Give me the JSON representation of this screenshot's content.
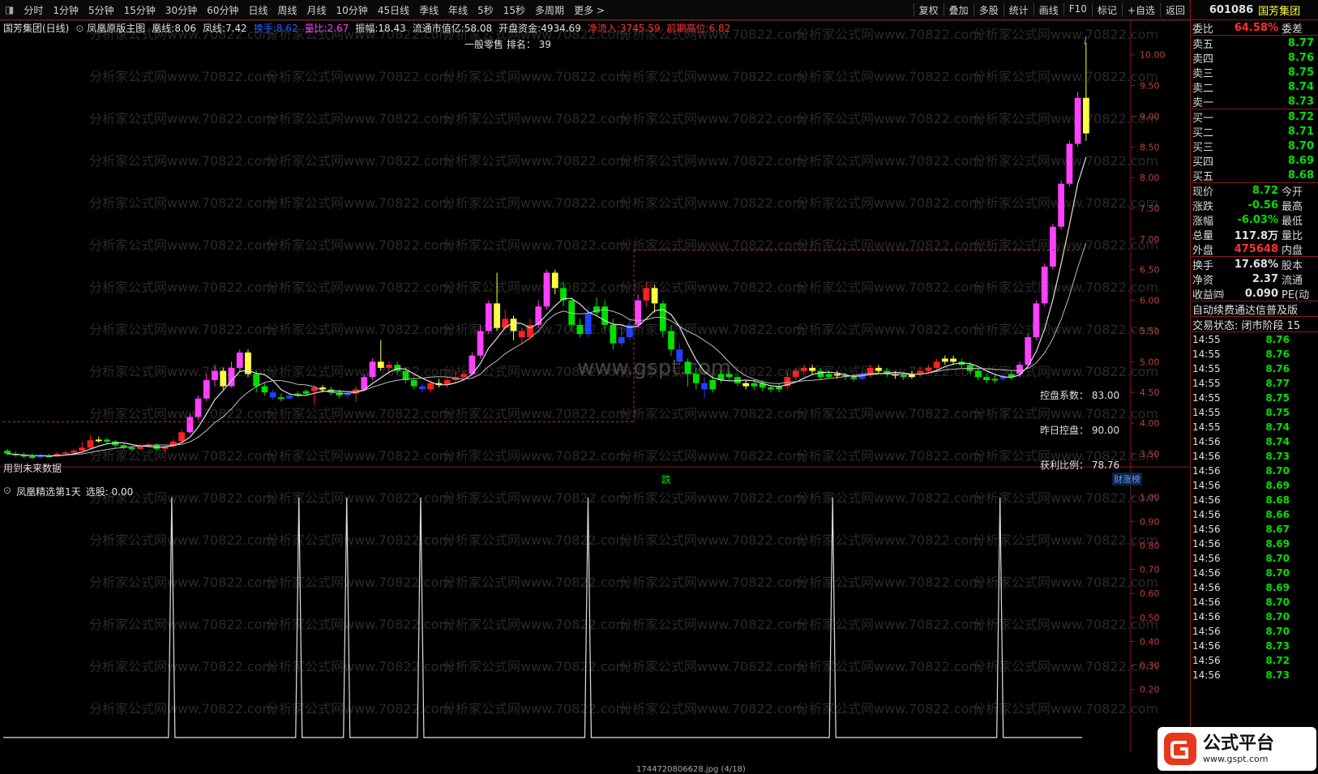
{
  "toolbar": {
    "periods": [
      "分时",
      "1分钟",
      "5分钟",
      "15分钟",
      "30分钟",
      "60分钟",
      "日线",
      "周线",
      "月线",
      "10分钟",
      "45日线",
      "季线",
      "年线",
      "5秒",
      "15秒",
      "多周期",
      "更多 >"
    ],
    "tools": [
      "复权",
      "叠加",
      "多股",
      "统计",
      "画线",
      "F10",
      "标记",
      "+自选",
      "返回"
    ]
  },
  "main_header": {
    "stock": "国芳集团(日线)",
    "indicator": "凤凰原版主图",
    "items": [
      {
        "label": "凰线:",
        "value": "8.06",
        "color": "#e0e0e0"
      },
      {
        "label": "凤线:",
        "value": "7.42",
        "color": "#e0e0e0"
      },
      {
        "label": "换手:",
        "value": "8.62",
        "color": "#2060ff"
      },
      {
        "label": "量比:",
        "value": "2.67",
        "color": "#ff40ff"
      },
      {
        "label": "振幅:",
        "value": "18.43",
        "color": "#e0e0e0"
      },
      {
        "label": "流通市值亿:",
        "value": "58.08",
        "color": "#e0e0e0"
      },
      {
        "label": "开盘资金:",
        "value": "4934.69",
        "color": "#e0e0e0"
      },
      {
        "label": "净流入:",
        "value": "3745.59",
        "color": "#ff3030"
      },
      {
        "label": "前期高位:",
        "value": "6.82",
        "color": "#ff3030"
      }
    ],
    "sector_rank": "一般零售 排名： 39"
  },
  "annotations": {
    "control_coef": "控盘系数： 83.00",
    "yesterday_control": "昨日控盘： 90.00",
    "profit_ratio": "获利比例： 78.76",
    "future_data": "用到未来数据",
    "drop_label": "跌",
    "caizhang": "财涨榜",
    "watermark_center": "www.gspt.com",
    "watermark_tile": "分析家公式网www.70822.com"
  },
  "sub_header": {
    "name": "凤凰精选第1天",
    "item": "选股: 0.00"
  },
  "price_axis": [
    "10.00",
    "9.50",
    "9.00",
    "8.50",
    "8.00",
    "7.50",
    "7.00",
    "6.50",
    "6.00",
    "5.50",
    "5.00",
    "4.50",
    "4.00",
    "3.50"
  ],
  "sub_axis": [
    "1.00",
    "0.90",
    "0.80",
    "0.70",
    "0.60",
    "0.50",
    "0.40",
    "0.30",
    "0.20"
  ],
  "right_panel": {
    "code": "601086",
    "name": "国芳集团",
    "webi": {
      "label": "委比",
      "value": "64.58%",
      "extra": "委差"
    },
    "asks": [
      {
        "label": "卖五",
        "price": "8.77"
      },
      {
        "label": "卖四",
        "price": "8.76"
      },
      {
        "label": "卖三",
        "price": "8.75"
      },
      {
        "label": "卖二",
        "price": "8.74"
      },
      {
        "label": "卖一",
        "price": "8.73"
      }
    ],
    "bids": [
      {
        "label": "买一",
        "price": "8.72"
      },
      {
        "label": "买二",
        "price": "8.71"
      },
      {
        "label": "买三",
        "price": "8.70"
      },
      {
        "label": "买四",
        "price": "8.69"
      },
      {
        "label": "买五",
        "price": "8.68"
      }
    ],
    "stats": [
      {
        "label": "现价",
        "value": "8.72",
        "extra": "今开",
        "color": "green"
      },
      {
        "label": "涨跌",
        "value": "-0.56",
        "extra": "最高",
        "color": "green"
      },
      {
        "label": "涨幅",
        "value": "-6.03%",
        "extra": "最低",
        "color": "green"
      },
      {
        "label": "总量",
        "value": "117.8万",
        "extra": "量比",
        "color": "white"
      },
      {
        "label": "外盘",
        "value": "475648",
        "extra": "内盘",
        "color": "red"
      }
    ],
    "stats2": [
      {
        "label": "换手",
        "value": "17.68%",
        "extra": "股本",
        "color": "white"
      },
      {
        "label": "净资",
        "value": "2.37",
        "extra": "流通",
        "color": "white"
      },
      {
        "label": "收益㈣",
        "value": "0.090",
        "extra": "PE(动",
        "color": "white"
      }
    ],
    "notice": "自动续费通达信普及版",
    "trade_status": "交易状态: 闭市阶段 15",
    "ticks": [
      {
        "t": "14:55",
        "p": "8.76"
      },
      {
        "t": "14:55",
        "p": "8.76"
      },
      {
        "t": "14:55",
        "p": "8.76"
      },
      {
        "t": "14:55",
        "p": "8.77"
      },
      {
        "t": "14:55",
        "p": "8.75"
      },
      {
        "t": "14:55",
        "p": "8.75"
      },
      {
        "t": "14:55",
        "p": "8.74"
      },
      {
        "t": "14:56",
        "p": "8.74"
      },
      {
        "t": "14:56",
        "p": "8.73"
      },
      {
        "t": "14:56",
        "p": "8.70"
      },
      {
        "t": "14:56",
        "p": "8.69"
      },
      {
        "t": "14:56",
        "p": "8.68"
      },
      {
        "t": "14:56",
        "p": "8.66"
      },
      {
        "t": "14:56",
        "p": "8.67"
      },
      {
        "t": "14:56",
        "p": "8.69"
      },
      {
        "t": "14:56",
        "p": "8.70"
      },
      {
        "t": "14:56",
        "p": "8.70"
      },
      {
        "t": "14:56",
        "p": "8.69"
      },
      {
        "t": "14:56",
        "p": "8.70"
      },
      {
        "t": "14:56",
        "p": "8.70"
      },
      {
        "t": "14:56",
        "p": "8.70"
      },
      {
        "t": "14:56",
        "p": "8.73"
      },
      {
        "t": "14:56",
        "p": "8.72"
      },
      {
        "t": "14:56",
        "p": "8.73"
      }
    ]
  },
  "logo": {
    "text": "公式平台",
    "url": "www.gspt.com"
  },
  "footer_file": "1744720806628.jpg (4/18)",
  "colors": {
    "up": "#ff40ff",
    "down": "#00e000",
    "neutral": "#ffff40",
    "blue": "#2040ff",
    "red": "#ff2020"
  },
  "chart_data": {
    "type": "candlestick",
    "ylim": [
      3.3,
      10.3
    ],
    "candles": [
      [
        3.55,
        3.5,
        3.58,
        3.47,
        "down"
      ],
      [
        3.5,
        3.48,
        3.54,
        3.45,
        "down"
      ],
      [
        3.48,
        3.46,
        3.52,
        3.43,
        "down"
      ],
      [
        3.46,
        3.44,
        3.5,
        3.41,
        "down"
      ],
      [
        3.44,
        3.47,
        3.5,
        3.42,
        "blue"
      ],
      [
        3.47,
        3.46,
        3.5,
        3.44,
        "down"
      ],
      [
        3.46,
        3.5,
        3.53,
        3.45,
        "red"
      ],
      [
        3.5,
        3.52,
        3.55,
        3.48,
        "red"
      ],
      [
        3.52,
        3.55,
        3.58,
        3.5,
        "red"
      ],
      [
        3.55,
        3.6,
        3.7,
        3.53,
        "red"
      ],
      [
        3.6,
        3.72,
        3.8,
        3.58,
        "red"
      ],
      [
        3.72,
        3.73,
        3.78,
        3.68,
        "neutral"
      ],
      [
        3.73,
        3.7,
        3.76,
        3.66,
        "down"
      ],
      [
        3.7,
        3.64,
        3.72,
        3.6,
        "down"
      ],
      [
        3.64,
        3.6,
        3.66,
        3.57,
        "down"
      ],
      [
        3.6,
        3.58,
        3.63,
        3.55,
        "down"
      ],
      [
        3.58,
        3.62,
        3.66,
        3.56,
        "red"
      ],
      [
        3.62,
        3.65,
        3.68,
        3.6,
        "red"
      ],
      [
        3.65,
        3.58,
        3.67,
        3.55,
        "down"
      ],
      [
        3.58,
        3.62,
        3.65,
        3.52,
        "red"
      ],
      [
        3.62,
        3.7,
        3.74,
        3.6,
        "red"
      ],
      [
        3.7,
        3.85,
        3.9,
        3.68,
        "red"
      ],
      [
        3.85,
        4.1,
        4.15,
        3.82,
        "up"
      ],
      [
        4.1,
        4.4,
        4.45,
        4.05,
        "up"
      ],
      [
        4.4,
        4.7,
        4.8,
        4.35,
        "up"
      ],
      [
        4.7,
        4.85,
        4.95,
        4.6,
        "up"
      ],
      [
        4.85,
        4.6,
        4.9,
        4.55,
        "neutral"
      ],
      [
        4.6,
        4.9,
        5.0,
        4.58,
        "up"
      ],
      [
        4.9,
        5.15,
        5.2,
        4.85,
        "up"
      ],
      [
        5.15,
        4.8,
        5.2,
        4.75,
        "neutral"
      ],
      [
        4.8,
        4.6,
        4.85,
        4.5,
        "down"
      ],
      [
        4.6,
        4.5,
        4.65,
        4.45,
        "down"
      ],
      [
        4.5,
        4.42,
        4.55,
        4.38,
        "blue"
      ],
      [
        4.42,
        4.4,
        4.48,
        4.35,
        "down"
      ],
      [
        4.4,
        4.45,
        4.5,
        4.38,
        "blue"
      ],
      [
        4.45,
        4.48,
        4.52,
        4.42,
        "down"
      ],
      [
        4.48,
        4.52,
        4.55,
        4.44,
        "down"
      ],
      [
        4.52,
        4.58,
        4.62,
        4.3,
        "red"
      ],
      [
        4.58,
        4.55,
        4.62,
        4.5,
        "neutral"
      ],
      [
        4.55,
        4.5,
        4.6,
        4.45,
        "down"
      ],
      [
        4.5,
        4.45,
        4.55,
        4.4,
        "down"
      ],
      [
        4.45,
        4.48,
        4.52,
        4.4,
        "blue"
      ],
      [
        4.48,
        4.55,
        4.6,
        4.35,
        "red"
      ],
      [
        4.55,
        4.75,
        4.8,
        4.52,
        "up"
      ],
      [
        4.75,
        5.0,
        5.05,
        4.7,
        "up"
      ],
      [
        5.0,
        4.9,
        5.35,
        4.85,
        "neutral"
      ],
      [
        4.9,
        4.95,
        5.0,
        4.85,
        "red"
      ],
      [
        4.95,
        4.85,
        5.0,
        4.8,
        "down"
      ],
      [
        4.85,
        4.7,
        4.9,
        4.65,
        "down"
      ],
      [
        4.7,
        4.6,
        4.75,
        4.55,
        "down"
      ],
      [
        4.6,
        4.55,
        4.65,
        4.5,
        "blue"
      ],
      [
        4.55,
        4.65,
        4.7,
        4.5,
        "red"
      ],
      [
        4.65,
        4.62,
        4.72,
        4.58,
        "neutral"
      ],
      [
        4.62,
        4.7,
        4.75,
        4.58,
        "red"
      ],
      [
        4.7,
        4.75,
        4.85,
        4.65,
        "red"
      ],
      [
        4.75,
        4.8,
        4.85,
        4.7,
        "red"
      ],
      [
        4.8,
        5.1,
        5.15,
        4.78,
        "up"
      ],
      [
        5.1,
        5.5,
        5.6,
        5.05,
        "up"
      ],
      [
        5.5,
        5.95,
        6.0,
        5.45,
        "up"
      ],
      [
        5.95,
        5.55,
        6.45,
        5.5,
        "neutral"
      ],
      [
        5.55,
        5.7,
        5.85,
        5.5,
        "red"
      ],
      [
        5.7,
        5.5,
        5.75,
        5.35,
        "neutral"
      ],
      [
        5.5,
        5.4,
        5.55,
        5.3,
        "red"
      ],
      [
        5.4,
        5.6,
        5.7,
        5.35,
        "red"
      ],
      [
        5.6,
        5.9,
        6.0,
        5.55,
        "up"
      ],
      [
        5.9,
        6.45,
        6.5,
        5.85,
        "up"
      ],
      [
        6.45,
        6.2,
        6.5,
        6.1,
        "neutral"
      ],
      [
        6.2,
        6.0,
        6.3,
        5.9,
        "down"
      ],
      [
        6.0,
        5.6,
        6.05,
        5.5,
        "down"
      ],
      [
        5.6,
        5.45,
        5.7,
        5.4,
        "down"
      ],
      [
        5.45,
        5.8,
        5.9,
        5.4,
        "blue"
      ],
      [
        5.8,
        5.9,
        6.05,
        5.75,
        "down"
      ],
      [
        5.9,
        5.6,
        6.0,
        5.5,
        "down"
      ],
      [
        5.6,
        5.3,
        5.7,
        5.2,
        "down"
      ],
      [
        5.3,
        5.4,
        5.55,
        5.25,
        "blue"
      ],
      [
        5.4,
        5.6,
        5.7,
        5.35,
        "blue"
      ],
      [
        5.6,
        6.0,
        6.1,
        5.55,
        "up"
      ],
      [
        6.0,
        6.2,
        6.3,
        5.9,
        "red"
      ],
      [
        6.2,
        5.95,
        6.25,
        5.8,
        "neutral"
      ],
      [
        5.95,
        5.5,
        6.0,
        5.4,
        "down"
      ],
      [
        5.5,
        5.2,
        5.6,
        5.1,
        "down"
      ],
      [
        5.2,
        5.0,
        5.3,
        4.95,
        "blue"
      ],
      [
        5.0,
        4.8,
        5.05,
        4.6,
        "down"
      ],
      [
        4.8,
        4.65,
        4.9,
        4.55,
        "down"
      ],
      [
        4.65,
        4.55,
        4.75,
        4.4,
        "blue"
      ],
      [
        4.55,
        4.7,
        4.8,
        4.5,
        "down"
      ],
      [
        4.7,
        4.8,
        4.85,
        4.65,
        "down"
      ],
      [
        4.8,
        4.75,
        4.85,
        4.7,
        "down"
      ],
      [
        4.75,
        4.65,
        4.8,
        4.6,
        "down"
      ],
      [
        4.65,
        4.6,
        4.7,
        4.55,
        "neutral"
      ],
      [
        4.6,
        4.65,
        4.7,
        4.55,
        "down"
      ],
      [
        4.65,
        4.58,
        4.7,
        4.52,
        "down"
      ],
      [
        4.58,
        4.55,
        4.62,
        4.5,
        "down"
      ],
      [
        4.55,
        4.6,
        4.65,
        4.5,
        "down"
      ],
      [
        4.6,
        4.75,
        4.85,
        4.55,
        "red"
      ],
      [
        4.75,
        4.85,
        4.9,
        4.7,
        "red"
      ],
      [
        4.85,
        4.9,
        4.95,
        4.8,
        "red"
      ],
      [
        4.9,
        4.85,
        4.95,
        4.8,
        "neutral"
      ],
      [
        4.85,
        4.75,
        4.9,
        4.7,
        "down"
      ],
      [
        4.75,
        4.8,
        4.85,
        4.72,
        "down"
      ],
      [
        4.8,
        4.78,
        4.85,
        4.72,
        "neutral"
      ],
      [
        4.78,
        4.75,
        4.82,
        4.7,
        "down"
      ],
      [
        4.75,
        4.72,
        4.8,
        4.68,
        "down"
      ],
      [
        4.72,
        4.8,
        4.85,
        4.7,
        "blue"
      ],
      [
        4.8,
        4.9,
        4.95,
        4.75,
        "red"
      ],
      [
        4.9,
        4.85,
        4.95,
        4.8,
        "neutral"
      ],
      [
        4.85,
        4.8,
        4.9,
        4.75,
        "down"
      ],
      [
        4.8,
        4.78,
        4.85,
        4.72,
        "neutral"
      ],
      [
        4.78,
        4.75,
        4.82,
        4.7,
        "down"
      ],
      [
        4.75,
        4.8,
        4.85,
        4.72,
        "neutral"
      ],
      [
        4.8,
        4.85,
        4.9,
        4.75,
        "red"
      ],
      [
        4.85,
        4.9,
        4.95,
        4.8,
        "red"
      ],
      [
        4.9,
        5.0,
        5.05,
        4.85,
        "red"
      ],
      [
        5.0,
        5.05,
        5.1,
        4.95,
        "neutral"
      ],
      [
        5.05,
        5.0,
        5.1,
        4.95,
        "neutral"
      ],
      [
        5.0,
        4.95,
        5.05,
        4.9,
        "down"
      ],
      [
        4.95,
        4.85,
        5.0,
        4.8,
        "down"
      ],
      [
        4.85,
        4.75,
        4.9,
        4.7,
        "down"
      ],
      [
        4.75,
        4.7,
        4.8,
        4.65,
        "down"
      ],
      [
        4.7,
        4.72,
        4.78,
        4.65,
        "down"
      ],
      [
        4.72,
        4.75,
        4.8,
        4.68,
        "blue"
      ],
      [
        4.75,
        4.8,
        4.85,
        4.7,
        "down"
      ],
      [
        4.8,
        4.95,
        5.0,
        4.75,
        "up"
      ],
      [
        4.95,
        5.4,
        5.45,
        4.9,
        "up"
      ],
      [
        5.4,
        5.95,
        6.0,
        5.35,
        "up"
      ],
      [
        5.95,
        6.55,
        6.6,
        5.9,
        "up"
      ],
      [
        6.55,
        7.2,
        7.25,
        6.5,
        "up"
      ],
      [
        7.2,
        7.9,
        7.95,
        7.15,
        "up"
      ],
      [
        7.9,
        8.55,
        8.6,
        7.85,
        "up"
      ],
      [
        8.55,
        9.3,
        9.4,
        8.5,
        "up"
      ],
      [
        9.3,
        8.72,
        10.2,
        8.6,
        "neutral"
      ]
    ],
    "selection_signal_x_fractions": [
      0.155,
      0.272,
      0.316,
      0.384,
      0.538,
      0.763,
      0.917
    ],
    "selection_signal_values": [
      1,
      1,
      1,
      1,
      1,
      1,
      1
    ]
  }
}
